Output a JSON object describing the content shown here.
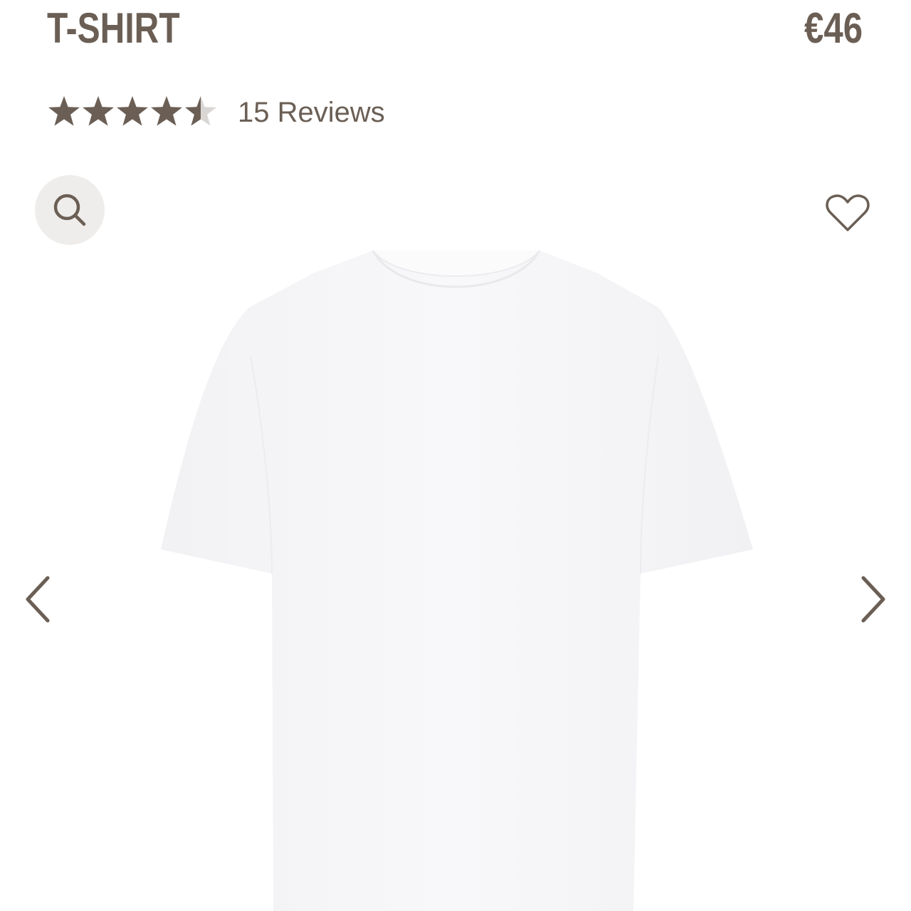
{
  "product": {
    "title": "T-SHIRT",
    "price": "€46",
    "rating": 4.5,
    "rating_max": 5,
    "reviews_label": "15 Reviews"
  },
  "gallery": {
    "zoom_icon": "search-icon",
    "wishlist_icon": "heart-outline-icon",
    "prev_icon": "chevron-left-icon",
    "next_icon": "chevron-right-icon"
  },
  "colors": {
    "text": "#6b5f55",
    "star_filled": "#6b5f55",
    "star_empty": "#d9d6d3",
    "zoom_bg": "#efedeb"
  }
}
